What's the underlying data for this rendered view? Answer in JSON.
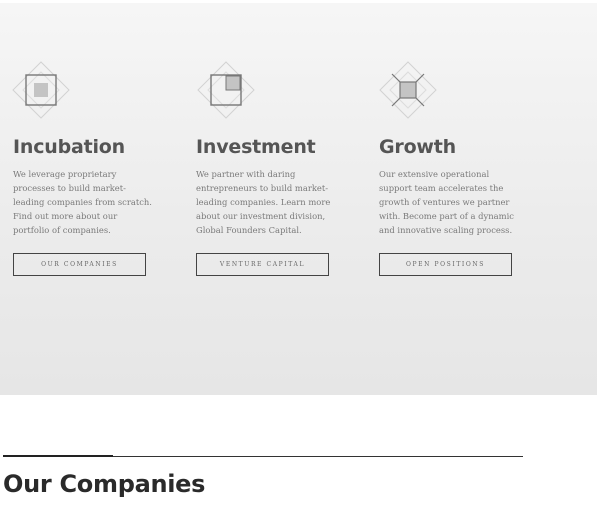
{
  "services": [
    {
      "icon": "square-diamond-icon",
      "title": "Incubation",
      "description": "We leverage proprietary processes to build market-leading companies from scratch. Find out more about our portfolio of companies.",
      "button_label": "OUR COMPANIES"
    },
    {
      "icon": "corner-square-diamond-icon",
      "title": "Investment",
      "description": "We partner with daring entrepreneurs to build market-leading companies. Learn more about our investment division, Global Founders Capital.",
      "button_label": "VENTURE CAPITAL"
    },
    {
      "icon": "cross-square-diamond-icon",
      "title": "Growth",
      "description": "Our extensive operational support team accelerates the growth of ventures we partner with. Become part of a dynamic and innovative scaling process.",
      "button_label": "OPEN POSITIONS"
    }
  ],
  "section": {
    "title": "Our Companies"
  },
  "colors": {
    "hero_background": "#ececec",
    "heading": "#555555",
    "body_text": "#7a7a7a",
    "button_border": "#444444",
    "section_title": "#2a2a2a"
  }
}
